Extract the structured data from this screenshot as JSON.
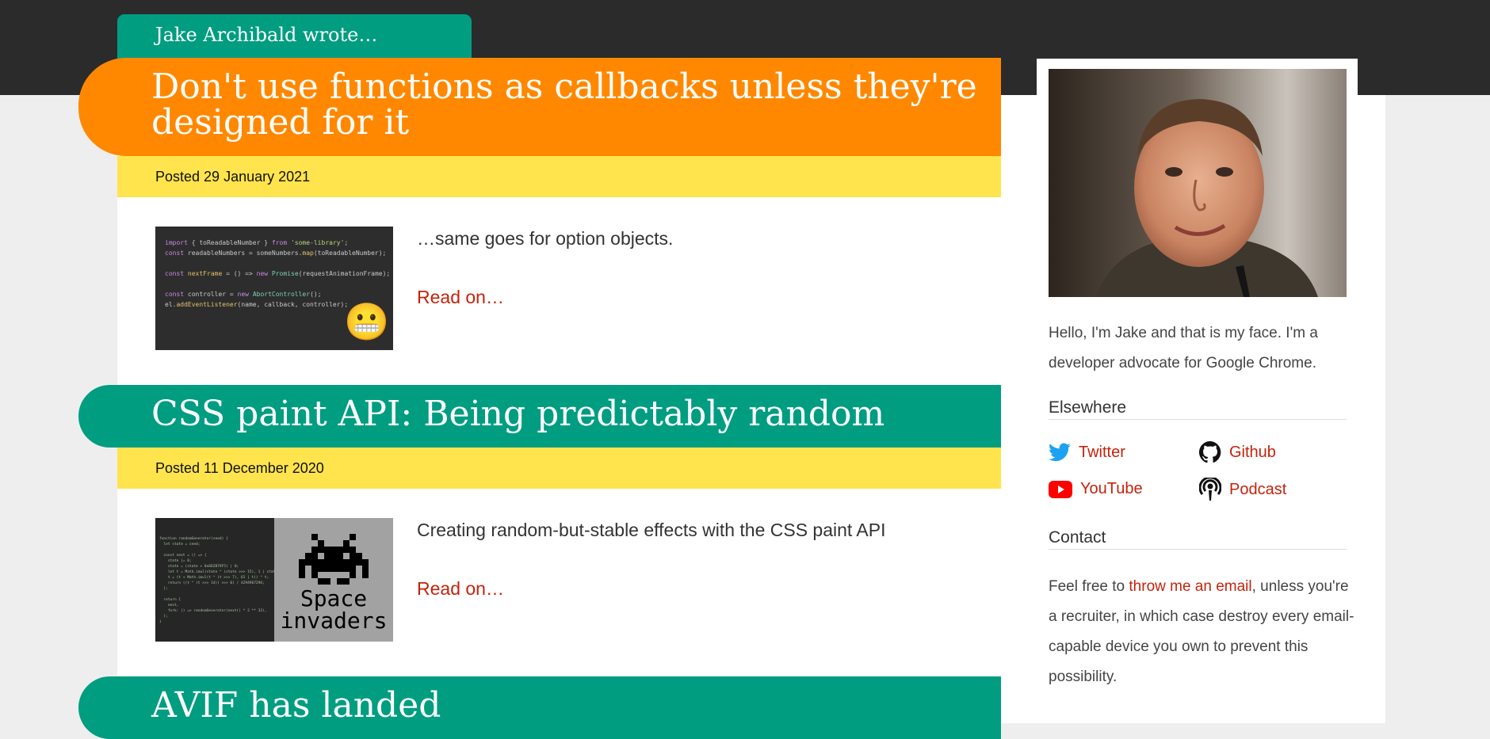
{
  "site": {
    "header_label": "Jake Archibald wrote…"
  },
  "posts": [
    {
      "title": "Don't use functions as callbacks unless they're designed for it",
      "date": "Posted 29 January 2021",
      "summary": "…same goes for option objects.",
      "read_on": "Read on…",
      "thumb_code": [
        "import { toReadableNumber } from 'some-library';",
        "const readableNumbers = someNumbers.map(toReadableNumber);",
        "const nextFrame = () => new Promise(requestAnimationFrame);",
        "const controller = new AbortController();",
        "el.addEventListener(name, callback, controller);"
      ],
      "thumb_emoji": "😬"
    },
    {
      "title": "CSS paint API: Being predictably random",
      "date": "Posted 11 December 2020",
      "summary": "Creating random-but-stable effects with the CSS paint API",
      "read_on": "Read on…",
      "thumb_code": [
        "function randomGenerator(seed) {",
        "  let state = seed;",
        "",
        "  const next = () => {",
        "    state |= 0;",
        "    state = (state + 0x6D2B79F5) | 0;",
        "    let t = Math.imul(state ^ (state >>> 15), 1 | state);",
        "    t = (t + Math.imul(t ^ (t >>> 7), 61 | t)) ^ t;",
        "    return ((t ^ (t >>> 14)) >>> 0) / 4294967296;",
        "  };",
        "",
        "  return {",
        "    next,",
        "    fork: () => randomGenerator(next() * 2 ** 32),",
        "  };",
        "}"
      ],
      "thumb_caption": [
        "Space",
        "invaders"
      ]
    },
    {
      "title": "AVIF has landed"
    }
  ],
  "sidebar": {
    "bio": "Hello, I'm Jake and that is my face. I'm a developer advocate for Google Chrome.",
    "elsewhere_heading": "Elsewhere",
    "links": [
      {
        "label": "Twitter",
        "icon": "twitter-icon",
        "color": "#1da1f2"
      },
      {
        "label": "Github",
        "icon": "github-icon",
        "color": "#111111"
      },
      {
        "label": "YouTube",
        "icon": "youtube-icon",
        "color": "#ff0000"
      },
      {
        "label": "Podcast",
        "icon": "podcast-icon",
        "color": "#111111"
      }
    ],
    "contact_heading": "Contact",
    "contact_before": "Feel free to ",
    "contact_link": "throw me an email",
    "contact_after": ", unless you're a recruiter, in which case destroy every email-capable device you own to prevent this possibility."
  },
  "colors": {
    "orange": "#ff8800",
    "green": "#009d81",
    "yellow": "#ffe44d",
    "link_red": "#c4230c",
    "dark_header": "#2b2b2b"
  }
}
